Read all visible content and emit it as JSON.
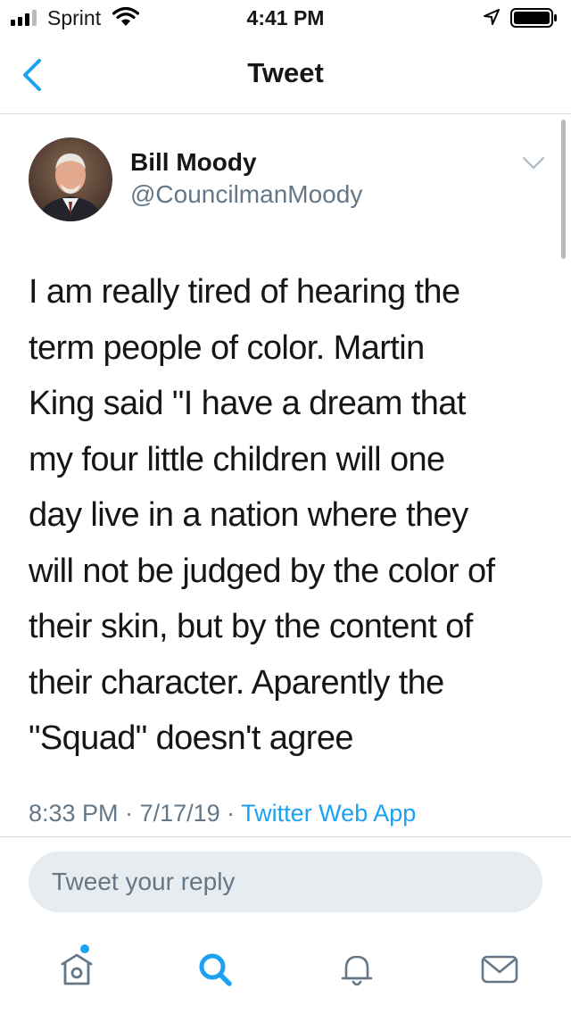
{
  "status_bar": {
    "carrier": "Sprint",
    "time": "4:41 PM"
  },
  "nav": {
    "title": "Tweet"
  },
  "tweet": {
    "display_name": "Bill Moody",
    "handle": "@CouncilmanMoody",
    "text": "I am really tired of hearing the\nterm people of color.  Martin\nKing said \"I have a dream that\nmy four little children will one\nday live in a nation where they\nwill not be judged by the color of\ntheir skin, but by the content of\ntheir character. Aparently the\n\"Squad\" doesn't agree",
    "time": "8:33 PM",
    "separator": " · ",
    "date": "7/17/19",
    "source": "Twitter Web App"
  },
  "reply": {
    "placeholder": "Tweet your reply"
  },
  "tab_bar": {
    "items": [
      {
        "icon": "home-icon",
        "has_notification_dot": true
      },
      {
        "icon": "search-icon",
        "active": true
      },
      {
        "icon": "bell-icon"
      },
      {
        "icon": "mail-icon"
      }
    ]
  },
  "colors": {
    "accent": "#1da1f2",
    "text_primary": "#14171a",
    "text_secondary": "#657786",
    "reply_bg": "#e6ecf0"
  }
}
